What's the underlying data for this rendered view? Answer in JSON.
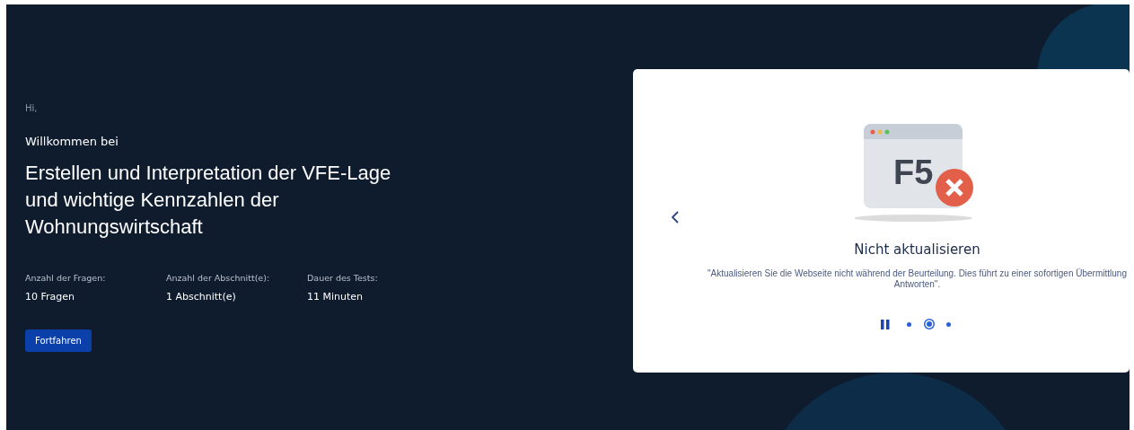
{
  "intro": {
    "greeting": "Hi,",
    "welcome": "Willkommen bei",
    "title": "Erstellen und Interpretation der VFE-Lage und wichtige Kennzahlen der Wohnungswirtschaft",
    "stats": [
      {
        "label": "Anzahl der Fragen:",
        "value": "10 Fragen"
      },
      {
        "label": "Anzahl der Abschnitt(e):",
        "value": "1 Abschnitt(e)"
      },
      {
        "label": "Dauer des Tests:",
        "value": "11 Minuten"
      }
    ],
    "button": "Fortfahren"
  },
  "carousel": {
    "illustration_key": "F5",
    "title": "Nicht aktualisieren",
    "description": "\"Aktualisieren Sie die Webseite nicht während der Beurteilung. Dies führt zu einer sofortigen Übermittlung\nAntworten\".",
    "slides": [
      {
        "selected": false
      },
      {
        "selected": true
      },
      {
        "selected": false
      }
    ]
  }
}
